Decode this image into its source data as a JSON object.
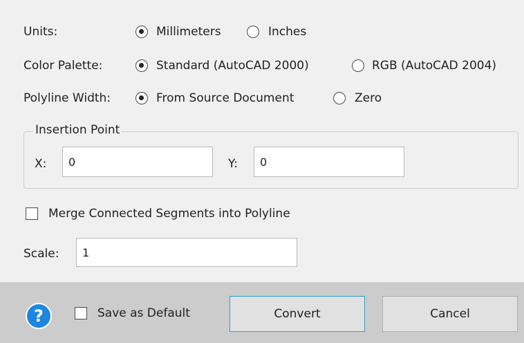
{
  "units": {
    "label": "Units:",
    "options": [
      "Millimeters",
      "Inches"
    ],
    "selected": "Millimeters"
  },
  "color_palette": {
    "label": "Color Palette:",
    "options": [
      "Standard (AutoCAD 2000)",
      "RGB (AutoCAD 2004)"
    ],
    "selected": "Standard (AutoCAD 2000)"
  },
  "polyline_width": {
    "label": "Polyline Width:",
    "options": [
      "From Source Document",
      "Zero"
    ],
    "selected": "From Source Document"
  },
  "insertion_point": {
    "title": "Insertion Point",
    "x_label": "X:",
    "x_value": "0",
    "y_label": "Y:",
    "y_value": "0"
  },
  "merge": {
    "label": "Merge Connected Segments into Polyline",
    "checked": false
  },
  "scale": {
    "label": "Scale:",
    "value": "1"
  },
  "footer": {
    "help_glyph": "?",
    "save_default_label": "Save as Default",
    "save_default_checked": false,
    "convert_label": "Convert",
    "cancel_label": "Cancel"
  },
  "colors": {
    "accent_border": "#2b9fc9",
    "help_icon": "#1e86e0",
    "footer_bg": "#cccccc",
    "dialog_bg": "#f0f0f0"
  }
}
